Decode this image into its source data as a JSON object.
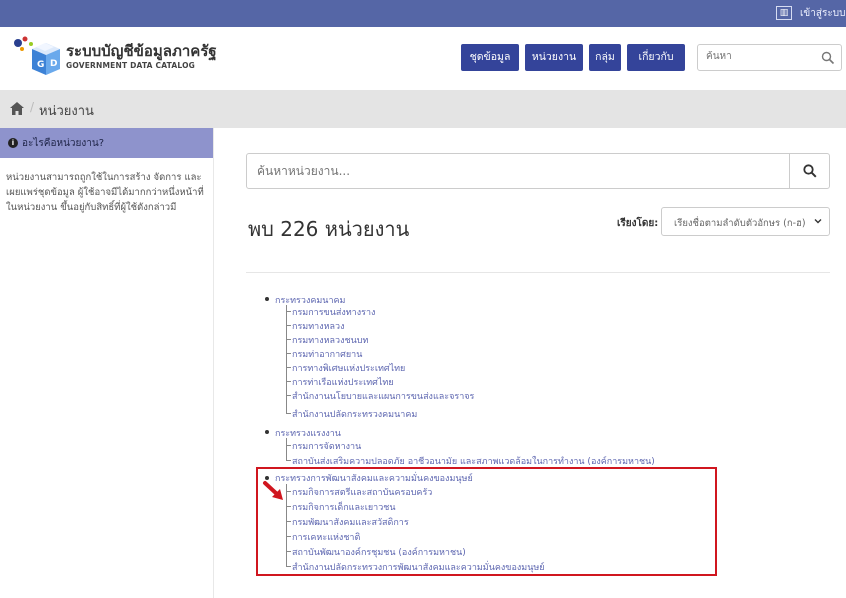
{
  "topbar": {
    "stats_icon": "chart-icon",
    "login_label": "เข้าสู่ระบบ"
  },
  "header": {
    "brand_title": "ระบบบัญชีข้อมูลภาครัฐ",
    "brand_subtitle": "GOVERNMENT DATA CATALOG",
    "nav": [
      {
        "label": "ชุดข้อมูล"
      },
      {
        "label": "หน่วยงาน"
      },
      {
        "label": "กลุ่ม"
      },
      {
        "label": "เกี่ยวกับ"
      }
    ],
    "search_placeholder": "ค้นหา"
  },
  "breadcrumb": {
    "home_icon": "home-icon",
    "current": "หน่วยงาน"
  },
  "sidebar": {
    "heading": "อะไรคือหน่วยงาน?",
    "description": "หน่วยงานสามารถถูกใช้ในการสร้าง จัดการ และเผยแพร่ชุดข้อมูล ผู้ใช้อาจมีได้มากกว่าหนึ่งหน้าที่ในหน่วยงาน ขึ้นอยู่กับสิทธิ์ที่ผู้ใช้ดังกล่าวมี"
  },
  "main": {
    "search_placeholder": "ค้นหาหน่วยงาน...",
    "result_title": "พบ 226 หน่วยงาน",
    "sort_label": "เรียงโดย:",
    "sort_value": "เรียงชื่อตามลำดับตัวอักษร (ก-ฮ)",
    "tree": [
      {
        "label": "กระทรวงคมนาคม",
        "children": [
          "กรมการขนส่งทางราง",
          "กรมทางหลวง",
          "กรมทางหลวงชนบท",
          "กรมท่าอากาศยาน",
          "การทางพิเศษแห่งประเทศไทย",
          "การท่าเรือแห่งประเทศไทย",
          "สำนักงานนโยบายและแผนการขนส่งและจราจร",
          "สำนักงานปลัดกระทรวงคมนาคม"
        ]
      },
      {
        "label": "กระทรวงแรงงาน",
        "children": [
          "กรมการจัดหางาน",
          "สถาบันส่งเสริมความปลอดภัย อาชีวอนามัย และสภาพแวดล้อมในการทำงาน (องค์การมหาชน)"
        ]
      },
      {
        "label": "กระทรวงการพัฒนาสังคมและความมั่นคงของมนุษย์",
        "children": [
          "กรมกิจการสตรีและสถาบันครอบครัว",
          "กรมกิจการเด็กและเยาวชน",
          "กรมพัฒนาสังคมและสวัสดิการ",
          "การเคหะแห่งชาติ",
          "สถาบันพัฒนาองค์กรชุมชน (องค์การมหาชน)",
          "สำนักงานปลัดกระทรวงการพัฒนาสังคมและความมั่นคงของมนุษย์"
        ]
      }
    ]
  }
}
